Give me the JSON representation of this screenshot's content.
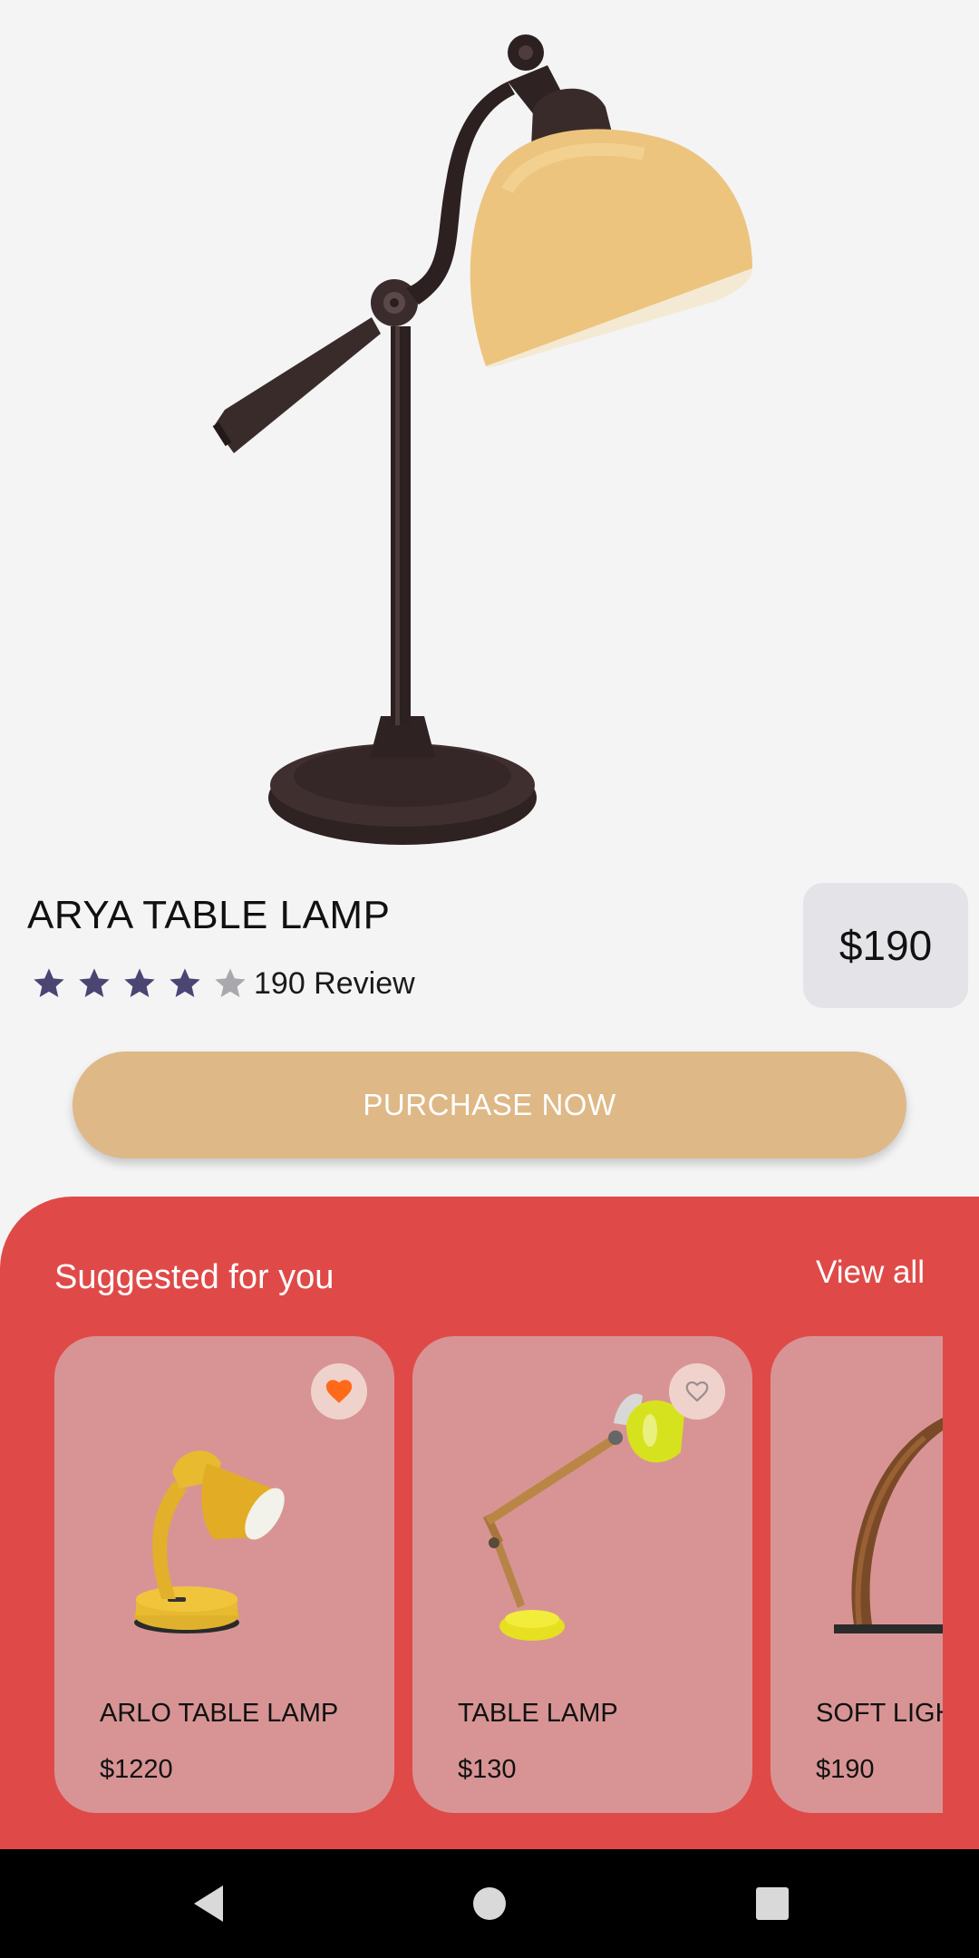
{
  "product": {
    "name": "ARYA TABLE LAMP",
    "review_text": "190 Review",
    "rating": 4,
    "rating_max": 5,
    "price": "$190"
  },
  "purchase_button": {
    "label": "PURCHASE NOW"
  },
  "suggested": {
    "title": "Suggested for you",
    "view_all": "View all",
    "items": [
      {
        "name": "ARLO TABLE LAMP",
        "price": "$1220",
        "favorite": true
      },
      {
        "name": "TABLE LAMP",
        "price": "$130",
        "favorite": false
      },
      {
        "name": "SOFT LIGHT",
        "price": "$190",
        "favorite": false
      }
    ]
  },
  "colors": {
    "accent_button": "#deb886",
    "suggested_bg": "#df4a48",
    "card_bg": "#d89494",
    "star_filled": "#4b4574",
    "star_empty": "#a9a9ad",
    "favorite_heart": "#ff6a1a"
  },
  "icons": {
    "star": "star-icon",
    "heart": "heart-icon",
    "back": "back-triangle-icon",
    "home": "home-circle-icon",
    "recents": "recents-square-icon"
  }
}
